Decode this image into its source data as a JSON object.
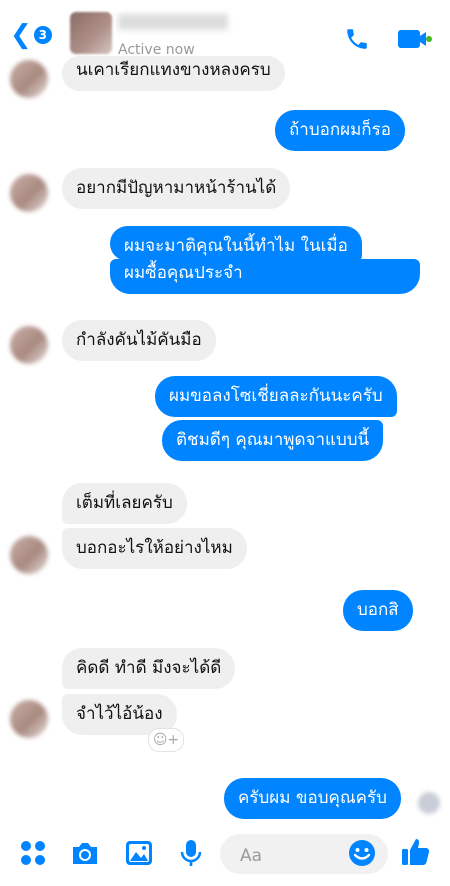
{
  "header": {
    "unread_count": "3",
    "status": "Active now"
  },
  "messages": [
    {
      "text": "นเคาเรียกแทงขางหลงครบ",
      "side": "in"
    },
    {
      "text": "ถ้าบอกผมก็รอ",
      "side": "out"
    },
    {
      "text": "อยากมีปัญหามาหน้าร้านได้",
      "side": "in"
    },
    {
      "text": "ผมจะมาติคุณในนี้ทำไม ในเมื่อ",
      "side": "out"
    },
    {
      "text": "ผมซื้อคุณประจำ",
      "side": "out"
    },
    {
      "text": "กำลังคันไม้คันมือ",
      "side": "in"
    },
    {
      "text": "ผมขอลงโซเชี่ยลละกันนะครับ",
      "side": "out"
    },
    {
      "text": "ติชมดีๆ คุณมาพูดจาแบบนี้",
      "side": "out"
    },
    {
      "text": "เต็มที่เลยครับ",
      "side": "in"
    },
    {
      "text": "บอกอะไรให้อย่างไหม",
      "side": "in"
    },
    {
      "text": "บอกสิ",
      "side": "out"
    },
    {
      "text": "คิดดี ทำดี มึงจะได้ดี",
      "side": "in"
    },
    {
      "text": "จำไว้ไอ้น้อง",
      "side": "in"
    },
    {
      "text": "ครับผม ขอบคุณครับ",
      "side": "out"
    }
  ],
  "composer": {
    "placeholder": "Aa"
  },
  "colors": {
    "accent": "#0084ff",
    "incoming_bubble": "#efefef",
    "online_dot": "#42b72a"
  }
}
